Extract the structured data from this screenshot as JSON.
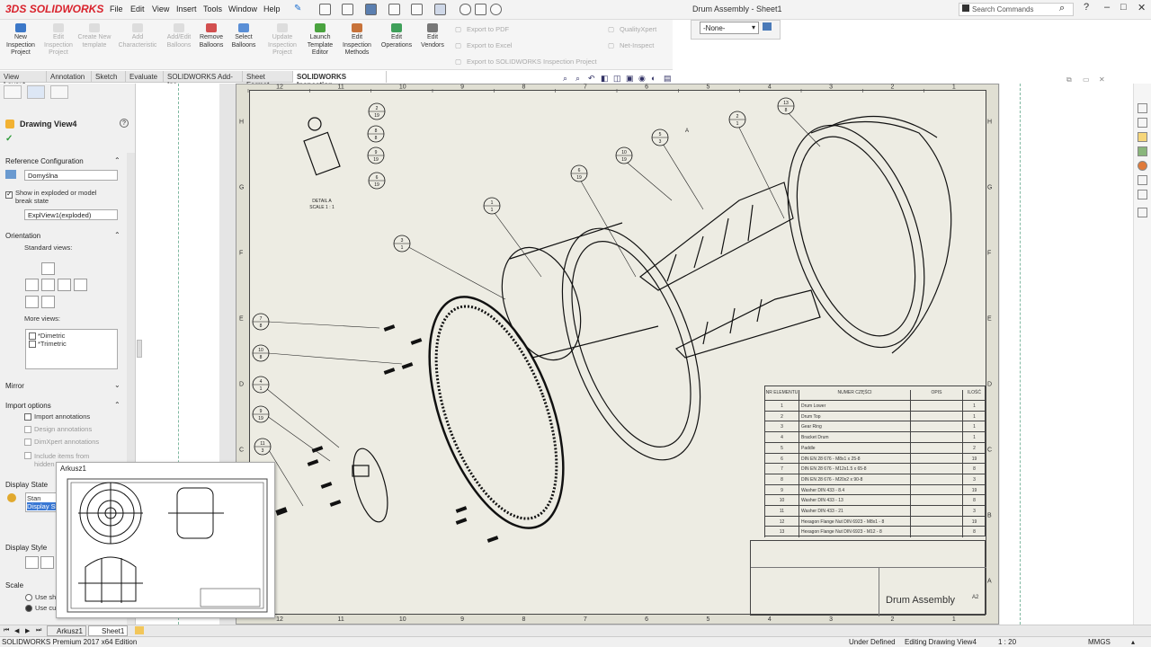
{
  "app": {
    "logo_text": "SOLIDWORKS",
    "logo_mark": "3DS",
    "accent": "#d9232d"
  },
  "menu": [
    "File",
    "Edit",
    "View",
    "Insert",
    "Tools",
    "Window",
    "Help"
  ],
  "window_title": "Drum Assembly - Sheet1",
  "search": {
    "placeholder": "Search Commands"
  },
  "window_buttons": {
    "help": "?",
    "minimize": "–",
    "restore": "□",
    "close": "✕"
  },
  "commands": [
    {
      "label": "New Inspection Project",
      "enabled": true
    },
    {
      "label": "Edit Inspection Project",
      "enabled": false
    },
    {
      "label": "Create New template",
      "enabled": false
    },
    {
      "label": "Add Characteristic",
      "enabled": false
    },
    {
      "label": "Add/Edit Balloons",
      "enabled": false
    },
    {
      "label": "Remove Balloons",
      "enabled": true
    },
    {
      "label": "Select Balloons",
      "enabled": true
    },
    {
      "label": "Update Inspection Project",
      "enabled": false
    },
    {
      "label": "Launch Template Editor",
      "enabled": true
    },
    {
      "label": "Edit Inspection Methods",
      "enabled": true
    },
    {
      "label": "Edit Operations",
      "enabled": true
    },
    {
      "label": "Edit Vendors",
      "enabled": true
    }
  ],
  "export_items": [
    "Export to PDF",
    "Export to Excel",
    "Export to SOLIDWORKS Inspection Project"
  ],
  "side_items": [
    "QualityXpert",
    "Net-Inspect"
  ],
  "config_select": "-None-",
  "tabs": [
    {
      "label": "View Layout",
      "active": false
    },
    {
      "label": "Annotation",
      "active": false
    },
    {
      "label": "Sketch",
      "active": false
    },
    {
      "label": "Evaluate",
      "active": false
    },
    {
      "label": "SOLIDWORKS Add-Ins",
      "active": false
    },
    {
      "label": "Sheet Format",
      "active": false
    },
    {
      "label": "SOLIDWORKS Inspection",
      "active": true
    }
  ],
  "property_manager": {
    "title": "Drawing View4",
    "help": "?",
    "ref_config": {
      "header": "Reference Configuration",
      "value": "Domyślna"
    },
    "show_exploded": {
      "label_line1": "Show in exploded or model",
      "label_line2": "break state",
      "checked": true
    },
    "exploded_select": "ExplView1(exploded)",
    "orientation": {
      "header": "Orientation",
      "standard_views": "Standard views:",
      "more_views": "More views:",
      "more_list": [
        "*Dimetric",
        "*Trimetric"
      ]
    },
    "mirror": "Mirror",
    "import_options": {
      "header": "Import options",
      "import_annotations": "Import annotations",
      "design_annotations": "Design annotations",
      "dimxpert": "DimXpert annotations",
      "include_line1": "Include items from",
      "include_line2": "hidden"
    },
    "display_state": {
      "header": "Display State",
      "item1": "Stan wyśw",
      "item2": "Display St"
    },
    "display_style": "Display Style",
    "scale": {
      "header": "Scale",
      "opt1": "Use she",
      "opt2": "Use cus"
    }
  },
  "popup": {
    "title": "Arkusz1"
  },
  "drawing": {
    "detail_label": "DETAIL A",
    "detail_scale": "SCALE 1 : 1",
    "zone_cols_top": [
      "12",
      "11",
      "10",
      "9",
      "8",
      "7",
      "6",
      "5",
      "4",
      "3",
      "2",
      "1"
    ],
    "zone_rows": [
      "H",
      "G",
      "F",
      "E",
      "D",
      "C",
      "B",
      "A"
    ],
    "balloons": [
      {
        "top": "2",
        "bottom": "19"
      },
      {
        "top": "8",
        "bottom": "8"
      },
      {
        "top": "9",
        "bottom": "19"
      },
      {
        "top": "6",
        "bottom": "19"
      },
      {
        "top": "1",
        "bottom": "1"
      },
      {
        "top": "3",
        "bottom": "1"
      },
      {
        "top": "6",
        "bottom": "19"
      },
      {
        "top": "10",
        "bottom": "19"
      },
      {
        "top": "5",
        "bottom": "3"
      },
      {
        "top": "2",
        "bottom": "1"
      },
      {
        "top": "13",
        "bottom": "8"
      },
      {
        "top": "7",
        "bottom": "8"
      },
      {
        "top": "10",
        "bottom": "8"
      },
      {
        "top": "4",
        "bottom": "1"
      },
      {
        "top": "9",
        "bottom": "19"
      },
      {
        "top": "11",
        "bottom": "3"
      }
    ],
    "view_label_a": "A"
  },
  "bom": {
    "headers": [
      "NR ELEMENTU",
      "NUMER CZĘŚCI",
      "OPIS",
      "ILOŚĆ"
    ],
    "rows": [
      [
        "1",
        "Drum Lower",
        "",
        "1"
      ],
      [
        "2",
        "Drum Top",
        "",
        "1"
      ],
      [
        "3",
        "Gear Ring",
        "",
        "1"
      ],
      [
        "4",
        "Bracket Drum",
        "",
        "1"
      ],
      [
        "5",
        "Paddle",
        "",
        "2"
      ],
      [
        "6",
        "DIN EN 28 676 - M8x1 x 25-8",
        "",
        "19"
      ],
      [
        "7",
        "DIN EN 28 676 - M12x1.5 x 65-8",
        "",
        "8"
      ],
      [
        "8",
        "DIN EN 28 676 - M20x2 x 90-8",
        "",
        "3"
      ],
      [
        "9",
        "Washer DIN 433 - 8.4",
        "",
        "19"
      ],
      [
        "10",
        "Washer DIN 433 - 13",
        "",
        "8"
      ],
      [
        "11",
        "Washer DIN 433 - 21",
        "",
        "3"
      ],
      [
        "12",
        "Hexagon Flange Nut DIN 6923 - M8x1 - 8",
        "",
        "19"
      ],
      [
        "13",
        "Hexagon Flange Nut DIN 6923 - M12 - 8",
        "",
        "8"
      ]
    ]
  },
  "title_block": {
    "name": "Drum Assembly",
    "size": "A2"
  },
  "sheet_tabs": [
    "Arkusz1",
    "Sheet1"
  ],
  "status": {
    "product": "SOLIDWORKS Premium 2017 x64 Edition",
    "defined": "Under Defined",
    "mode": "Editing Drawing View4",
    "scale": "1 : 20",
    "units": "MMGS"
  }
}
